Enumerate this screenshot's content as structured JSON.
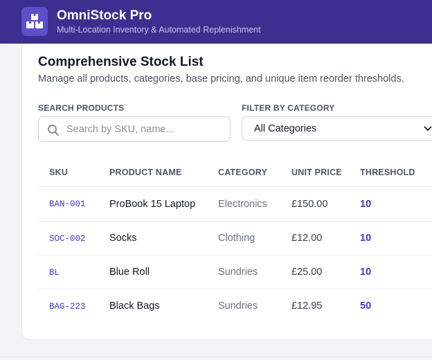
{
  "app": {
    "title": "OmniStock Pro",
    "subtitle": "Multi-Location Inventory & Automated Replenishment"
  },
  "page": {
    "title": "Comprehensive Stock List",
    "description": "Manage all products, categories, base pricing, and unique item reorder thresholds."
  },
  "filters": {
    "search_label": "SEARCH PRODUCTS",
    "search_placeholder": "Search by SKU, name...",
    "search_value": "",
    "category_label": "FILTER BY CATEGORY",
    "category_selected": "All Categories"
  },
  "table": {
    "headers": [
      "SKU",
      "PRODUCT NAME",
      "CATEGORY",
      "UNIT PRICE",
      "THRESHOLD"
    ],
    "rows": [
      {
        "sku": "BAN-001",
        "name": "ProBook 15 Laptop",
        "category": "Electronics",
        "price": "£150.00",
        "threshold": "10"
      },
      {
        "sku": "SOC-002",
        "name": "Socks",
        "category": "Clothing",
        "price": "£12.00",
        "threshold": "10"
      },
      {
        "sku": "BL",
        "name": "Blue Roll",
        "category": "Sundries",
        "price": "£25.00",
        "threshold": "10"
      },
      {
        "sku": "BAG-223",
        "name": "Black Bags",
        "category": "Sundries",
        "price": "£12.95",
        "threshold": "50"
      }
    ]
  },
  "colors": {
    "header_bg": "#3b2f8f",
    "accent": "#4338ca",
    "logo_bg": "#5b50c9"
  },
  "icons": {
    "logo": "boxes-icon",
    "search": "search-icon",
    "select_caret": "chevron-down-icon"
  }
}
